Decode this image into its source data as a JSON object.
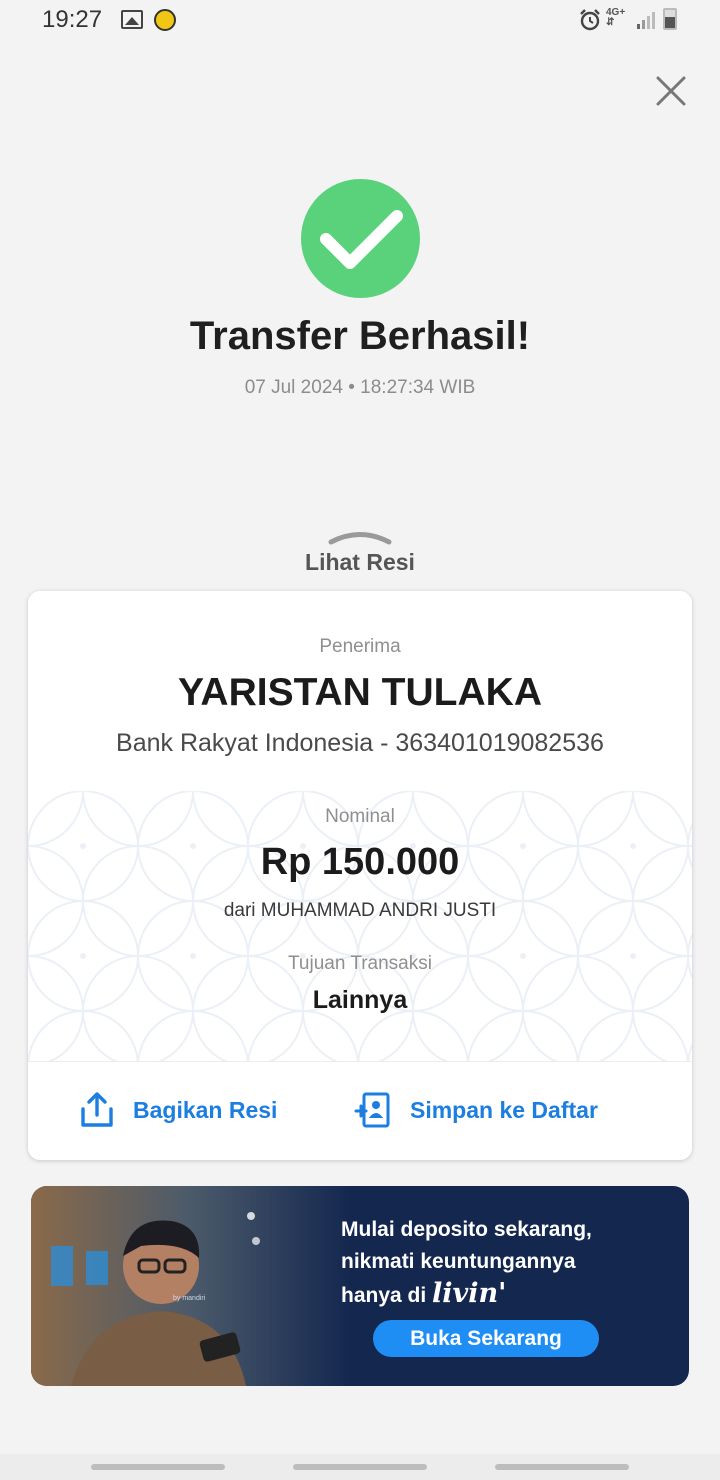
{
  "status_bar": {
    "time": "19:27",
    "network": "4G+",
    "icons": [
      "image-icon",
      "app-notification-icon",
      "alarm-icon",
      "signal-icon",
      "battery-icon"
    ]
  },
  "header": {
    "close_icon": "close-icon"
  },
  "result": {
    "title": "Transfer Berhasil!",
    "datetime": "07 Jul 2024 • 18:27:34 WIB",
    "icon": "check-circle-icon",
    "color": "#5ad27c"
  },
  "receipt_toggle": {
    "label": "Lihat Resi"
  },
  "receipt": {
    "recipient_label": "Penerima",
    "recipient_name": "YARISTAN TULAKA",
    "recipient_bank": "Bank Rakyat Indonesia - 363401019082536",
    "amount_label": "Nominal",
    "amount": "Rp 150.000",
    "sender": "dari MUHAMMAD ANDRI JUSTI",
    "purpose_label": "Tujuan Transaksi",
    "purpose": "Lainnya"
  },
  "actions": {
    "share_label": "Bagikan Resi",
    "save_label": "Simpan ke Daftar",
    "accent": "#1b7ee0"
  },
  "banner": {
    "line1": "Mulai deposito sekarang,",
    "line2": "nikmati keuntungannya",
    "line3": "hanya di",
    "logo": "livin'",
    "logo_sub": "by mandiri",
    "cta": "Buka Sekarang",
    "bg": "#14274f",
    "cta_color": "#1e8ef5"
  }
}
